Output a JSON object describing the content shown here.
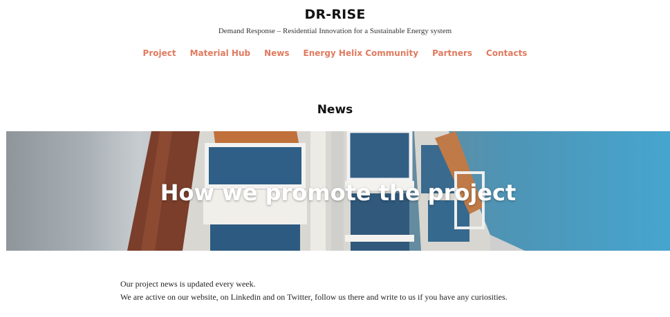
{
  "site": {
    "title": "DR-RISE",
    "tagline": "Demand Response – Residential Innovation for a Sustainable Energy system"
  },
  "nav": {
    "items": [
      {
        "label": "Project"
      },
      {
        "label": "Material Hub"
      },
      {
        "label": "News"
      },
      {
        "label": "Energy Helix Community"
      },
      {
        "label": "Partners"
      },
      {
        "label": "Contacts"
      }
    ],
    "color": "#e07a5f"
  },
  "page": {
    "heading": "News"
  },
  "hero": {
    "title": "How we promote the project"
  },
  "content": {
    "line1": "Our project news is updated every week.",
    "line2": "We are active on our website, on Linkedin and on Twitter, follow us there and write to us if you have any curiosities."
  }
}
